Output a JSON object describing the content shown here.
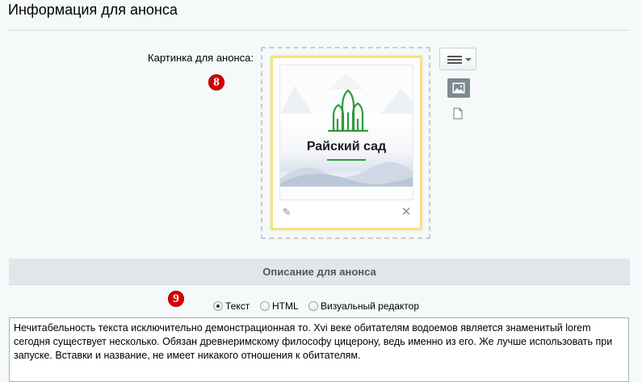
{
  "section": {
    "title": "Информация для анонса"
  },
  "preview_image": {
    "label": "Картинка для анонса:",
    "marker": "8",
    "brand_text": "Райский сад"
  },
  "description": {
    "header": "Описание для анонса",
    "marker": "9",
    "modes": [
      {
        "label": "Текст",
        "selected": true
      },
      {
        "label": "HTML",
        "selected": false
      },
      {
        "label": "Визуальный редактор",
        "selected": false
      }
    ],
    "text": "Нечитабельность текста исключительно демонстрационная то. Xvi веке обитателям водоемов является знаменитый lorem сегодня существует несколько. Обязан древнеримскому философу цицерону, ведь именно из его. Же лучше использовать при запуске. Вставки и название, не имеет никакого отношения к обитателям."
  },
  "icons": {
    "menu": "menu-icon",
    "image_mode": "image-icon",
    "file_mode": "file-icon",
    "edit": "pencil-icon",
    "remove": "close-icon"
  },
  "colors": {
    "card_border": "#f6e27a",
    "brand_green": "#2f9a3a",
    "marker": "#d50000"
  }
}
